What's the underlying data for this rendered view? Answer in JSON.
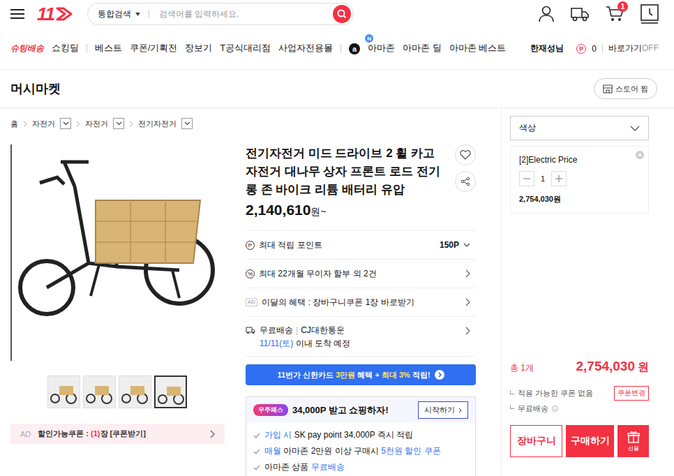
{
  "header": {
    "logo": "11",
    "search_scope": "통합검색",
    "search": {
      "placeholder": "검색어를 입력하세요."
    },
    "cart_badge": "1"
  },
  "nav": {
    "brand": "슈팅배송",
    "items": [
      "쇼킹딜",
      "베스트",
      "쿠폰/기획전",
      "장보기",
      "T공식대리점",
      "사업자전용몰"
    ],
    "amazon_logo": "a",
    "amazon_items": [
      {
        "label": "아마존",
        "badge": "N"
      },
      {
        "label": "아마존 딜"
      },
      {
        "label": "아마존 베스트"
      }
    ],
    "user": "한재성님",
    "points_icon": "P",
    "points": "0",
    "shortcut": "바로가기",
    "shortcut_state": "OFF"
  },
  "store": {
    "name": "머시마켓",
    "follow_button": "스토어 찜"
  },
  "breadcrumb": [
    {
      "label": "홈",
      "has_dropdown": false
    },
    {
      "label": "자전거",
      "has_dropdown": true
    },
    {
      "label": "자전거",
      "has_dropdown": true
    },
    {
      "label": "전기자전거",
      "has_dropdown": true
    }
  ],
  "product": {
    "title": "전기자전거 미드 드라이브 2 휠 카고 자전거 대나무 상자 프론트 로드 전기 롱 존 바이크 리튬 배터리 유압",
    "price": "2,140,610",
    "price_suffix": "원~",
    "thumbnails": [
      {
        "selected": false
      },
      {
        "selected": false
      },
      {
        "selected": false
      },
      {
        "selected": true
      }
    ],
    "coupon_bar": {
      "ad": "AD",
      "label": "할인가능쿠폰 : ",
      "count": "(1)",
      "suffix": "장 [쿠폰받기]"
    },
    "points": {
      "icon": "P",
      "label": "최대 적립 포인트",
      "value": "150P"
    },
    "installment": {
      "icon": "%",
      "label": "최대 22개월 무이자 할부 외 2건"
    },
    "benefit": {
      "ad": "AD",
      "label": "이달의 혜택 : 장바구니쿠폰 1장 바로받기"
    },
    "shipping": {
      "label": "무료배송",
      "separator": "|",
      "carrier": "CJ대한통운",
      "eta_date": "11/11(토)",
      "eta_text": " 이내 도착 예정"
    },
    "card_banner": [
      {
        "text": "11번가 신한카드 ",
        "highlight": false
      },
      {
        "text": "3만원",
        "highlight": true
      },
      {
        "text": " 혜택 + ",
        "highlight": false
      },
      {
        "text": "최대 3%",
        "highlight": true
      },
      {
        "text": " 적립!",
        "highlight": false
      }
    ],
    "pass": {
      "badge": "우주패스",
      "headline": "34,000P 받고 쇼핑하자!",
      "button": "시작하기",
      "benefits": [
        [
          {
            "text": "가입 시",
            "highlight": true
          },
          {
            "text": " SK pay point 34,000P 즉시 적립",
            "highlight": false
          }
        ],
        [
          {
            "text": "매월",
            "highlight": true
          },
          {
            "text": " 아마존 2만원 이상 구매시 ",
            "highlight": false
          },
          {
            "text": "5천원",
            "highlight": true
          },
          {
            "text": " 할인 쿠폰",
            "highlight": true
          }
        ],
        [
          {
            "text": "아마존 상품 ",
            "highlight": false
          },
          {
            "text": "무료배송",
            "highlight": true
          }
        ]
      ]
    }
  },
  "sidebar": {
    "option_label": "색상",
    "selected_option": {
      "name": "[2]Electric Price",
      "quantity": "1",
      "price": "2,754,030원"
    },
    "total_count": "총 1개",
    "total_price": "2,754,030",
    "total_unit": "원",
    "coupon_text": "적용 가능한 쿠폰 없음",
    "coupon_button": "쿠폰변경",
    "shipping": "무료배송",
    "buttons": {
      "cart": "장바구니",
      "buy": "구매하기",
      "gift": "선물"
    }
  }
}
